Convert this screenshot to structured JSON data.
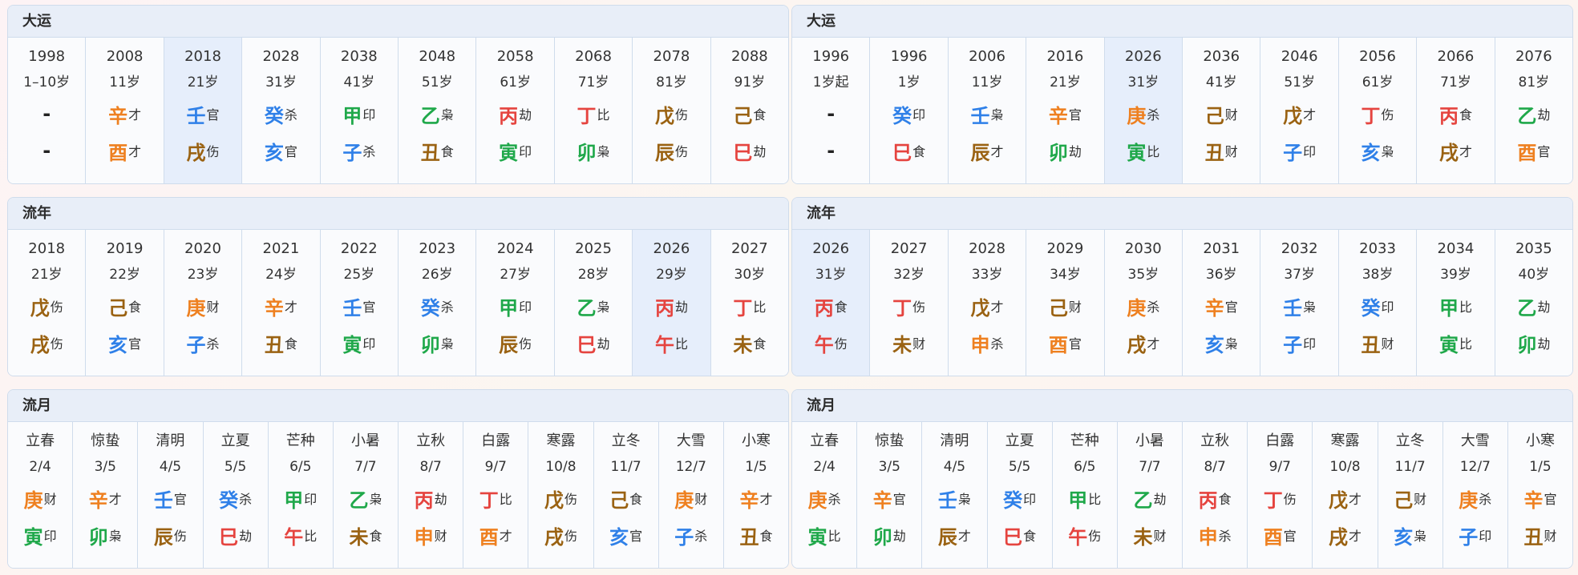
{
  "colors": {
    "fire": "#e5443f",
    "water": "#2f80e8",
    "wood": "#1fa84a",
    "earth": "#9a6212",
    "metal": "#ee8020"
  },
  "left": {
    "dayun": {
      "title": "大运",
      "cells": [
        {
          "l1": "1998",
          "l2": "1–10岁",
          "gan": {
            "dash": "-"
          },
          "zhi": {
            "dash": "-"
          }
        },
        {
          "l1": "2008",
          "l2": "11岁",
          "gan": {
            "c": "辛",
            "s": "才",
            "e": "metal"
          },
          "zhi": {
            "c": "酉",
            "s": "才",
            "e": "metal"
          }
        },
        {
          "l1": "2018",
          "l2": "21岁",
          "hl": true,
          "gan": {
            "c": "壬",
            "s": "官",
            "e": "water"
          },
          "zhi": {
            "c": "戌",
            "s": "伤",
            "e": "earth"
          }
        },
        {
          "l1": "2028",
          "l2": "31岁",
          "gan": {
            "c": "癸",
            "s": "杀",
            "e": "water"
          },
          "zhi": {
            "c": "亥",
            "s": "官",
            "e": "water"
          }
        },
        {
          "l1": "2038",
          "l2": "41岁",
          "gan": {
            "c": "甲",
            "s": "印",
            "e": "wood"
          },
          "zhi": {
            "c": "子",
            "s": "杀",
            "e": "water"
          }
        },
        {
          "l1": "2048",
          "l2": "51岁",
          "gan": {
            "c": "乙",
            "s": "枭",
            "e": "wood"
          },
          "zhi": {
            "c": "丑",
            "s": "食",
            "e": "earth"
          }
        },
        {
          "l1": "2058",
          "l2": "61岁",
          "gan": {
            "c": "丙",
            "s": "劫",
            "e": "fire"
          },
          "zhi": {
            "c": "寅",
            "s": "印",
            "e": "wood"
          }
        },
        {
          "l1": "2068",
          "l2": "71岁",
          "gan": {
            "c": "丁",
            "s": "比",
            "e": "fire"
          },
          "zhi": {
            "c": "卯",
            "s": "枭",
            "e": "wood"
          }
        },
        {
          "l1": "2078",
          "l2": "81岁",
          "gan": {
            "c": "戊",
            "s": "伤",
            "e": "earth"
          },
          "zhi": {
            "c": "辰",
            "s": "伤",
            "e": "earth"
          }
        },
        {
          "l1": "2088",
          "l2": "91岁",
          "gan": {
            "c": "己",
            "s": "食",
            "e": "earth"
          },
          "zhi": {
            "c": "巳",
            "s": "劫",
            "e": "fire"
          }
        }
      ]
    },
    "liunian": {
      "title": "流年",
      "cells": [
        {
          "l1": "2018",
          "l2": "21岁",
          "gan": {
            "c": "戊",
            "s": "伤",
            "e": "earth"
          },
          "zhi": {
            "c": "戌",
            "s": "伤",
            "e": "earth"
          }
        },
        {
          "l1": "2019",
          "l2": "22岁",
          "gan": {
            "c": "己",
            "s": "食",
            "e": "earth"
          },
          "zhi": {
            "c": "亥",
            "s": "官",
            "e": "water"
          }
        },
        {
          "l1": "2020",
          "l2": "23岁",
          "gan": {
            "c": "庚",
            "s": "财",
            "e": "metal"
          },
          "zhi": {
            "c": "子",
            "s": "杀",
            "e": "water"
          }
        },
        {
          "l1": "2021",
          "l2": "24岁",
          "gan": {
            "c": "辛",
            "s": "才",
            "e": "metal"
          },
          "zhi": {
            "c": "丑",
            "s": "食",
            "e": "earth"
          }
        },
        {
          "l1": "2022",
          "l2": "25岁",
          "gan": {
            "c": "壬",
            "s": "官",
            "e": "water"
          },
          "zhi": {
            "c": "寅",
            "s": "印",
            "e": "wood"
          }
        },
        {
          "l1": "2023",
          "l2": "26岁",
          "gan": {
            "c": "癸",
            "s": "杀",
            "e": "water"
          },
          "zhi": {
            "c": "卯",
            "s": "枭",
            "e": "wood"
          }
        },
        {
          "l1": "2024",
          "l2": "27岁",
          "gan": {
            "c": "甲",
            "s": "印",
            "e": "wood"
          },
          "zhi": {
            "c": "辰",
            "s": "伤",
            "e": "earth"
          }
        },
        {
          "l1": "2025",
          "l2": "28岁",
          "gan": {
            "c": "乙",
            "s": "枭",
            "e": "wood"
          },
          "zhi": {
            "c": "巳",
            "s": "劫",
            "e": "fire"
          }
        },
        {
          "l1": "2026",
          "l2": "29岁",
          "hl": true,
          "gan": {
            "c": "丙",
            "s": "劫",
            "e": "fire"
          },
          "zhi": {
            "c": "午",
            "s": "比",
            "e": "fire"
          }
        },
        {
          "l1": "2027",
          "l2": "30岁",
          "gan": {
            "c": "丁",
            "s": "比",
            "e": "fire"
          },
          "zhi": {
            "c": "未",
            "s": "食",
            "e": "earth"
          }
        }
      ]
    },
    "liuyue": {
      "title": "流月",
      "cells": [
        {
          "l1": "立春",
          "l2": "2/4",
          "gan": {
            "c": "庚",
            "s": "财",
            "e": "metal"
          },
          "zhi": {
            "c": "寅",
            "s": "印",
            "e": "wood"
          }
        },
        {
          "l1": "惊蛰",
          "l2": "3/5",
          "gan": {
            "c": "辛",
            "s": "才",
            "e": "metal"
          },
          "zhi": {
            "c": "卯",
            "s": "枭",
            "e": "wood"
          }
        },
        {
          "l1": "清明",
          "l2": "4/5",
          "gan": {
            "c": "壬",
            "s": "官",
            "e": "water"
          },
          "zhi": {
            "c": "辰",
            "s": "伤",
            "e": "earth"
          }
        },
        {
          "l1": "立夏",
          "l2": "5/5",
          "gan": {
            "c": "癸",
            "s": "杀",
            "e": "water"
          },
          "zhi": {
            "c": "巳",
            "s": "劫",
            "e": "fire"
          }
        },
        {
          "l1": "芒种",
          "l2": "6/5",
          "gan": {
            "c": "甲",
            "s": "印",
            "e": "wood"
          },
          "zhi": {
            "c": "午",
            "s": "比",
            "e": "fire"
          }
        },
        {
          "l1": "小暑",
          "l2": "7/7",
          "gan": {
            "c": "乙",
            "s": "枭",
            "e": "wood"
          },
          "zhi": {
            "c": "未",
            "s": "食",
            "e": "earth"
          }
        },
        {
          "l1": "立秋",
          "l2": "8/7",
          "gan": {
            "c": "丙",
            "s": "劫",
            "e": "fire"
          },
          "zhi": {
            "c": "申",
            "s": "财",
            "e": "metal"
          }
        },
        {
          "l1": "白露",
          "l2": "9/7",
          "gan": {
            "c": "丁",
            "s": "比",
            "e": "fire"
          },
          "zhi": {
            "c": "酉",
            "s": "才",
            "e": "metal"
          }
        },
        {
          "l1": "寒露",
          "l2": "10/8",
          "gan": {
            "c": "戊",
            "s": "伤",
            "e": "earth"
          },
          "zhi": {
            "c": "戌",
            "s": "伤",
            "e": "earth"
          }
        },
        {
          "l1": "立冬",
          "l2": "11/7",
          "gan": {
            "c": "己",
            "s": "食",
            "e": "earth"
          },
          "zhi": {
            "c": "亥",
            "s": "官",
            "e": "water"
          }
        },
        {
          "l1": "大雪",
          "l2": "12/7",
          "gan": {
            "c": "庚",
            "s": "财",
            "e": "metal"
          },
          "zhi": {
            "c": "子",
            "s": "杀",
            "e": "water"
          }
        },
        {
          "l1": "小寒",
          "l2": "1/5",
          "gan": {
            "c": "辛",
            "s": "才",
            "e": "metal"
          },
          "zhi": {
            "c": "丑",
            "s": "食",
            "e": "earth"
          }
        }
      ]
    }
  },
  "right": {
    "dayun": {
      "title": "大运",
      "cells": [
        {
          "l1": "1996",
          "l2": "1岁起",
          "gan": {
            "dash": "-"
          },
          "zhi": {
            "dash": "-"
          }
        },
        {
          "l1": "1996",
          "l2": "1岁",
          "gan": {
            "c": "癸",
            "s": "印",
            "e": "water"
          },
          "zhi": {
            "c": "巳",
            "s": "食",
            "e": "fire"
          }
        },
        {
          "l1": "2006",
          "l2": "11岁",
          "gan": {
            "c": "壬",
            "s": "枭",
            "e": "water"
          },
          "zhi": {
            "c": "辰",
            "s": "才",
            "e": "earth"
          }
        },
        {
          "l1": "2016",
          "l2": "21岁",
          "gan": {
            "c": "辛",
            "s": "官",
            "e": "metal"
          },
          "zhi": {
            "c": "卯",
            "s": "劫",
            "e": "wood"
          }
        },
        {
          "l1": "2026",
          "l2": "31岁",
          "hl": true,
          "gan": {
            "c": "庚",
            "s": "杀",
            "e": "metal"
          },
          "zhi": {
            "c": "寅",
            "s": "比",
            "e": "wood"
          }
        },
        {
          "l1": "2036",
          "l2": "41岁",
          "gan": {
            "c": "己",
            "s": "财",
            "e": "earth"
          },
          "zhi": {
            "c": "丑",
            "s": "财",
            "e": "earth"
          }
        },
        {
          "l1": "2046",
          "l2": "51岁",
          "gan": {
            "c": "戊",
            "s": "才",
            "e": "earth"
          },
          "zhi": {
            "c": "子",
            "s": "印",
            "e": "water"
          }
        },
        {
          "l1": "2056",
          "l2": "61岁",
          "gan": {
            "c": "丁",
            "s": "伤",
            "e": "fire"
          },
          "zhi": {
            "c": "亥",
            "s": "枭",
            "e": "water"
          }
        },
        {
          "l1": "2066",
          "l2": "71岁",
          "gan": {
            "c": "丙",
            "s": "食",
            "e": "fire"
          },
          "zhi": {
            "c": "戌",
            "s": "才",
            "e": "earth"
          }
        },
        {
          "l1": "2076",
          "l2": "81岁",
          "gan": {
            "c": "乙",
            "s": "劫",
            "e": "wood"
          },
          "zhi": {
            "c": "酉",
            "s": "官",
            "e": "metal"
          }
        }
      ]
    },
    "liunian": {
      "title": "流年",
      "cells": [
        {
          "l1": "2026",
          "l2": "31岁",
          "hl": true,
          "gan": {
            "c": "丙",
            "s": "食",
            "e": "fire"
          },
          "zhi": {
            "c": "午",
            "s": "伤",
            "e": "fire"
          }
        },
        {
          "l1": "2027",
          "l2": "32岁",
          "gan": {
            "c": "丁",
            "s": "伤",
            "e": "fire"
          },
          "zhi": {
            "c": "未",
            "s": "财",
            "e": "earth"
          }
        },
        {
          "l1": "2028",
          "l2": "33岁",
          "gan": {
            "c": "戊",
            "s": "才",
            "e": "earth"
          },
          "zhi": {
            "c": "申",
            "s": "杀",
            "e": "metal"
          }
        },
        {
          "l1": "2029",
          "l2": "34岁",
          "gan": {
            "c": "己",
            "s": "财",
            "e": "earth"
          },
          "zhi": {
            "c": "酉",
            "s": "官",
            "e": "metal"
          }
        },
        {
          "l1": "2030",
          "l2": "35岁",
          "gan": {
            "c": "庚",
            "s": "杀",
            "e": "metal"
          },
          "zhi": {
            "c": "戌",
            "s": "才",
            "e": "earth"
          }
        },
        {
          "l1": "2031",
          "l2": "36岁",
          "gan": {
            "c": "辛",
            "s": "官",
            "e": "metal"
          },
          "zhi": {
            "c": "亥",
            "s": "枭",
            "e": "water"
          }
        },
        {
          "l1": "2032",
          "l2": "37岁",
          "gan": {
            "c": "壬",
            "s": "枭",
            "e": "water"
          },
          "zhi": {
            "c": "子",
            "s": "印",
            "e": "water"
          }
        },
        {
          "l1": "2033",
          "l2": "38岁",
          "gan": {
            "c": "癸",
            "s": "印",
            "e": "water"
          },
          "zhi": {
            "c": "丑",
            "s": "财",
            "e": "earth"
          }
        },
        {
          "l1": "2034",
          "l2": "39岁",
          "gan": {
            "c": "甲",
            "s": "比",
            "e": "wood"
          },
          "zhi": {
            "c": "寅",
            "s": "比",
            "e": "wood"
          }
        },
        {
          "l1": "2035",
          "l2": "40岁",
          "gan": {
            "c": "乙",
            "s": "劫",
            "e": "wood"
          },
          "zhi": {
            "c": "卯",
            "s": "劫",
            "e": "wood"
          }
        }
      ]
    },
    "liuyue": {
      "title": "流月",
      "cells": [
        {
          "l1": "立春",
          "l2": "2/4",
          "gan": {
            "c": "庚",
            "s": "杀",
            "e": "metal"
          },
          "zhi": {
            "c": "寅",
            "s": "比",
            "e": "wood"
          }
        },
        {
          "l1": "惊蛰",
          "l2": "3/5",
          "gan": {
            "c": "辛",
            "s": "官",
            "e": "metal"
          },
          "zhi": {
            "c": "卯",
            "s": "劫",
            "e": "wood"
          }
        },
        {
          "l1": "清明",
          "l2": "4/5",
          "gan": {
            "c": "壬",
            "s": "枭",
            "e": "water"
          },
          "zhi": {
            "c": "辰",
            "s": "才",
            "e": "earth"
          }
        },
        {
          "l1": "立夏",
          "l2": "5/5",
          "gan": {
            "c": "癸",
            "s": "印",
            "e": "water"
          },
          "zhi": {
            "c": "巳",
            "s": "食",
            "e": "fire"
          }
        },
        {
          "l1": "芒种",
          "l2": "6/5",
          "gan": {
            "c": "甲",
            "s": "比",
            "e": "wood"
          },
          "zhi": {
            "c": "午",
            "s": "伤",
            "e": "fire"
          }
        },
        {
          "l1": "小暑",
          "l2": "7/7",
          "gan": {
            "c": "乙",
            "s": "劫",
            "e": "wood"
          },
          "zhi": {
            "c": "未",
            "s": "财",
            "e": "earth"
          }
        },
        {
          "l1": "立秋",
          "l2": "8/7",
          "gan": {
            "c": "丙",
            "s": "食",
            "e": "fire"
          },
          "zhi": {
            "c": "申",
            "s": "杀",
            "e": "metal"
          }
        },
        {
          "l1": "白露",
          "l2": "9/7",
          "gan": {
            "c": "丁",
            "s": "伤",
            "e": "fire"
          },
          "zhi": {
            "c": "酉",
            "s": "官",
            "e": "metal"
          }
        },
        {
          "l1": "寒露",
          "l2": "10/8",
          "gan": {
            "c": "戊",
            "s": "才",
            "e": "earth"
          },
          "zhi": {
            "c": "戌",
            "s": "才",
            "e": "earth"
          }
        },
        {
          "l1": "立冬",
          "l2": "11/7",
          "gan": {
            "c": "己",
            "s": "财",
            "e": "earth"
          },
          "zhi": {
            "c": "亥",
            "s": "枭",
            "e": "water"
          }
        },
        {
          "l1": "大雪",
          "l2": "12/7",
          "gan": {
            "c": "庚",
            "s": "杀",
            "e": "metal"
          },
          "zhi": {
            "c": "子",
            "s": "印",
            "e": "water"
          }
        },
        {
          "l1": "小寒",
          "l2": "1/5",
          "gan": {
            "c": "辛",
            "s": "官",
            "e": "metal"
          },
          "zhi": {
            "c": "丑",
            "s": "财",
            "e": "earth"
          }
        }
      ]
    }
  }
}
